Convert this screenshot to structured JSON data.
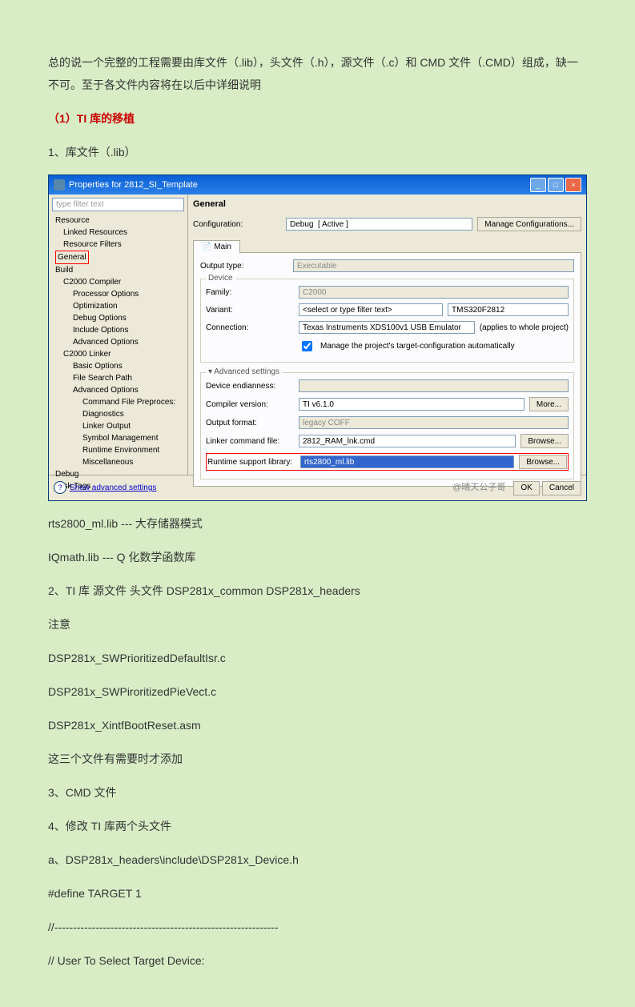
{
  "doc": {
    "p1": "总的说一个完整的工程需要由库文件（.lib），头文件（.h），源文件（.c）和 CMD 文件（.CMD）组成，缺一不可。至于各文件内容将在以后中详细说明",
    "h1": "（1）TI 库的移植",
    "p2": "1、库文件（.lib）",
    "p3": "rts2800_ml.lib    ---    大存储器模式",
    "p4": "IQmath.lib         ---     Q 化数学函数库",
    "p5": "2、TI 库 源文件    头文件 DSP281x_common DSP281x_headers",
    "p6": "注意",
    "p7": "DSP281x_SWPrioritizedDefaultIsr.c",
    "p8": "DSP281x_SWPiroritizedPieVect.c",
    "p9": "DSP281x_XintfBootReset.asm",
    "p10": "这三个文件有需要时才添加",
    "p11": "3、CMD 文件",
    "p12": "4、修改 TI 库两个头文件",
    "p13": "a、DSP281x_headers\\include\\DSP281x_Device.h",
    "p14": "#define      TARGET      1",
    "p15": "//------------------------------------------------------------",
    "p16": "// User To Select Target Device:"
  },
  "dlg": {
    "title": "Properties for 2812_SI_Template",
    "filter": "type filter text",
    "tree": {
      "n0": "Resource",
      "n0a": "Linked Resources",
      "n0b": "Resource Filters",
      "n1": "General",
      "n2": "Build",
      "n2a": "C2000 Compiler",
      "n2a1": "Processor Options",
      "n2a2": "Optimization",
      "n2a3": "Debug Options",
      "n2a4": "Include Options",
      "n2a5": "Advanced Options",
      "n2b": "C2000 Linker",
      "n2b1": "Basic Options",
      "n2b2": "File Search Path",
      "n2b3": "Advanced Options",
      "n2b3a": "Command File Preproces:",
      "n2b3b": "Diagnostics",
      "n2b3c": "Linker Output",
      "n2b3d": "Symbol Management",
      "n2b3e": "Runtime Environment",
      "n2b3f": "Miscellaneous",
      "n3": "Debug",
      "n4": "Task Tags"
    },
    "gen": {
      "title": "General",
      "cfg_l": "Configuration:",
      "cfg_v": "Debug  [ Active ]",
      "cfg_btn": "Manage Configurations...",
      "tab": "Main",
      "out_l": "Output type:",
      "out_v": "Executable",
      "dev": "Device",
      "fam_l": "Family:",
      "fam_v": "C2000",
      "var_l": "Variant:",
      "var_v": "<select or type filter text>",
      "var2": "TMS320F2812",
      "con_l": "Connection:",
      "con_v": "Texas Instruments XDS100v1 USB Emulator",
      "con_n": "(applies to whole project)",
      "chk": "Manage the project's target-configuration automatically",
      "adv": "Advanced settings",
      "end_l": "Device endianness:",
      "comp_l": "Compiler version:",
      "comp_v": "TI v6.1.0",
      "more": "More...",
      "of_l": "Output format:",
      "of_v": "legacy COFF",
      "lnk_l": "Linker command file:",
      "lnk_v": "2812_RAM_lnk.cmd",
      "br": "Browse...",
      "rt_l": "Runtime support library:",
      "rt_v": "rts2800_ml.lib"
    },
    "ft": {
      "show": "Show advanced settings",
      "water": "@晴天公子哥",
      "ok": "OK",
      "cancel": "Cancel"
    }
  }
}
